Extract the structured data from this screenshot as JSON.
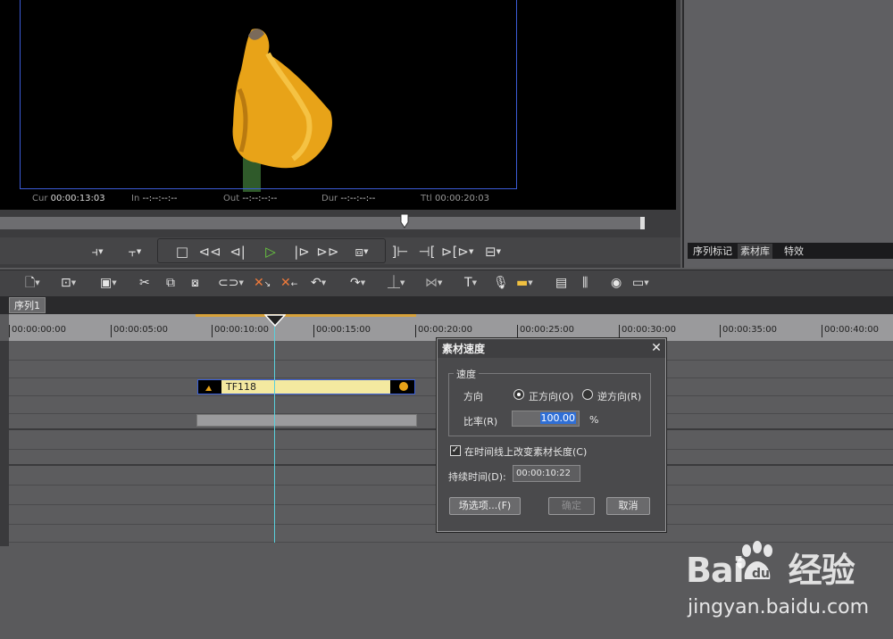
{
  "preview": {
    "timecodes": [
      {
        "label": "Cur",
        "value": "00:00:13:03"
      },
      {
        "label": "In",
        "value": "--:--:--:--"
      },
      {
        "label": "Out",
        "value": "--:--:--:--"
      },
      {
        "label": "Dur",
        "value": "--:--:--:--"
      },
      {
        "label": "Ttl",
        "value": "00:00:20:03"
      }
    ],
    "scrub_progress": 0.63
  },
  "transport": {
    "icons": [
      "mark-in-icon",
      "mark-out-icon",
      "stop-icon",
      "rewind-icon",
      "step-back-icon",
      "play-icon",
      "step-forward-icon",
      "fast-forward-icon",
      "loop-icon",
      "prev-edit-icon",
      "next-edit-icon",
      "split-icon",
      "export-icon"
    ]
  },
  "right_panel": {
    "tabs": [
      "序列标记",
      "素材库",
      "特效"
    ],
    "active_tab": "素材库"
  },
  "toolbar": {
    "icons": [
      "new-icon",
      "open-icon",
      "save-icon",
      "cut-icon",
      "copy-icon",
      "paste-icon",
      "link-icon",
      "delete-in-icon",
      "delete-out-icon",
      "undo-icon",
      "redo-icon",
      "audio-icon",
      "transition-icon",
      "title-icon",
      "mic-icon",
      "render-icon",
      "panel-icon",
      "mixer-icon",
      "color-icon",
      "window-icon"
    ]
  },
  "timeline": {
    "sequence_tab": "序列1",
    "ruler_labels": [
      "00:00:00:00",
      "00:00:05:00",
      "00:00:10:00",
      "00:00:15:00",
      "00:00:20:00",
      "00:00:25:00",
      "00:00:30:00",
      "00:00:35:00",
      "00:00:40:00"
    ],
    "clip_name": "TF118"
  },
  "dialog": {
    "title": "素材速度",
    "group_label": "速度",
    "direction_label": "方向",
    "forward_label": "正方向(O)",
    "reverse_label": "逆方向(R)",
    "direction_selected": "forward",
    "rate_label": "比率(R)",
    "rate_value": "100.00",
    "rate_unit": "%",
    "change_length_label": "在时间线上改变素材长度(C)",
    "change_length_checked": true,
    "duration_label": "持续时间(D):",
    "duration_value": "00:00:10:22",
    "field_options_label": "场选项...(F)",
    "ok_label": "确定",
    "cancel_label": "取消"
  },
  "watermark": {
    "logo": "Bai du 经验",
    "url": "jingyan.baidu.com"
  },
  "colors": {
    "accent_blue": "#3b5bd6",
    "playhead": "#5ad0dc",
    "clip_fill": "#f4e9a0",
    "inout_bar": "#d8a23a",
    "play_green": "#6bd13f"
  }
}
